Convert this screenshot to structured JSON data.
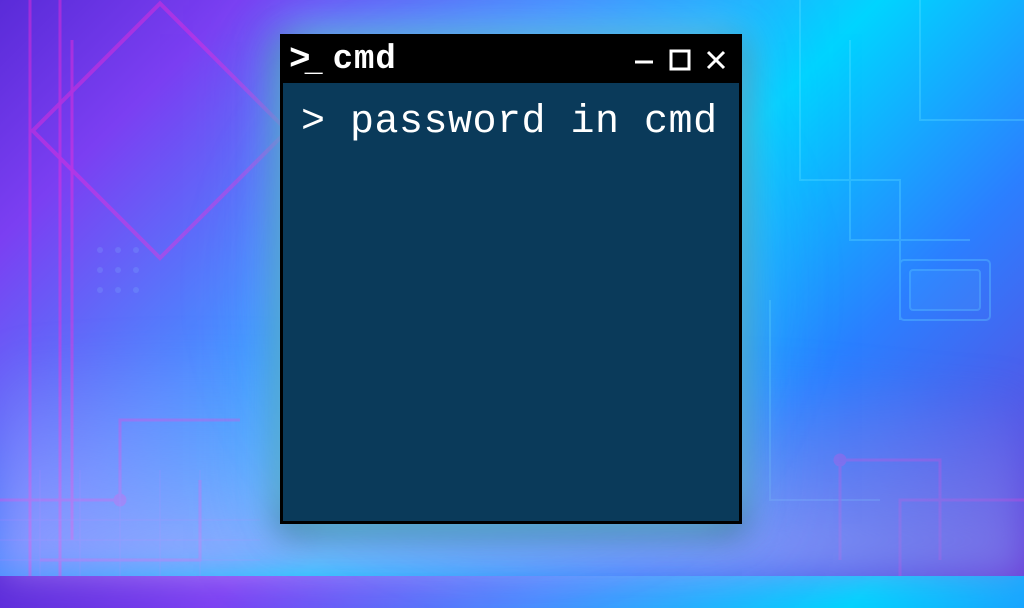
{
  "window": {
    "title": "cmd",
    "icon_name": "terminal-prompt-icon"
  },
  "terminal": {
    "prompt_symbol": ">",
    "command_text": "> password in cmd"
  },
  "colors": {
    "titlebar_bg": "#000000",
    "terminal_bg": "#0a3a5a",
    "text": "#ffffff"
  }
}
